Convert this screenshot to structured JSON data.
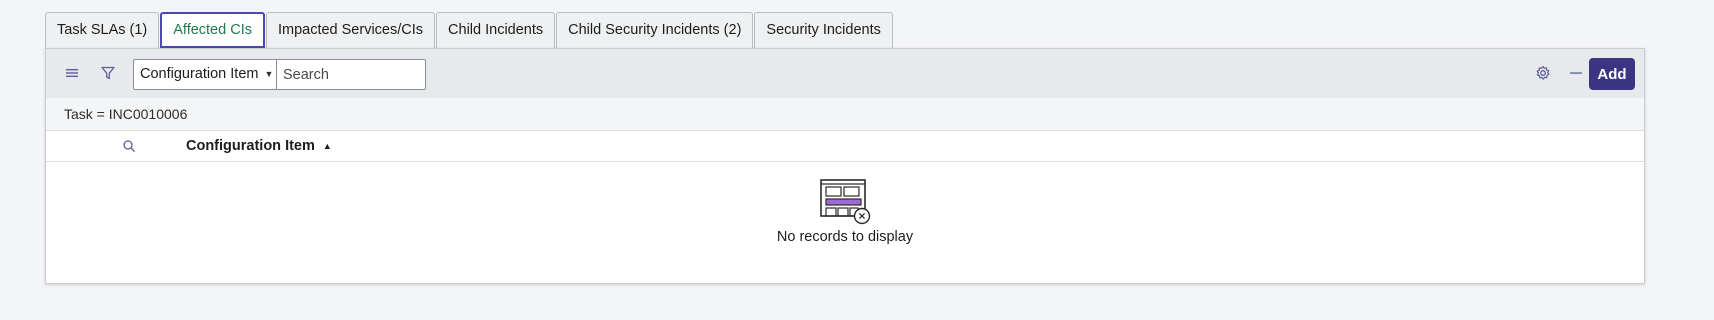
{
  "tabs": [
    {
      "label": "Task SLAs (1)",
      "active": false
    },
    {
      "label": "Affected CIs",
      "active": true
    },
    {
      "label": "Impacted Services/CIs",
      "active": false
    },
    {
      "label": "Child Incidents",
      "active": false
    },
    {
      "label": "Child Security Incidents (2)",
      "active": false
    },
    {
      "label": "Security Incidents",
      "active": false
    }
  ],
  "toolbar": {
    "field_select_value": "Configuration Item",
    "search_placeholder": "Search",
    "add_label": "Add"
  },
  "filter": {
    "breadcrumb": "Task = INC0010006"
  },
  "table": {
    "columns": [
      "Configuration Item"
    ],
    "sort_direction": "ascending",
    "rows": []
  },
  "empty_state": {
    "message": "No records to display"
  },
  "colors": {
    "accent": "#3b3583",
    "active_tab_text": "#1f7a4e",
    "active_tab_border": "#4b47b8",
    "empty_icon_purple": "#9b6ad6"
  }
}
